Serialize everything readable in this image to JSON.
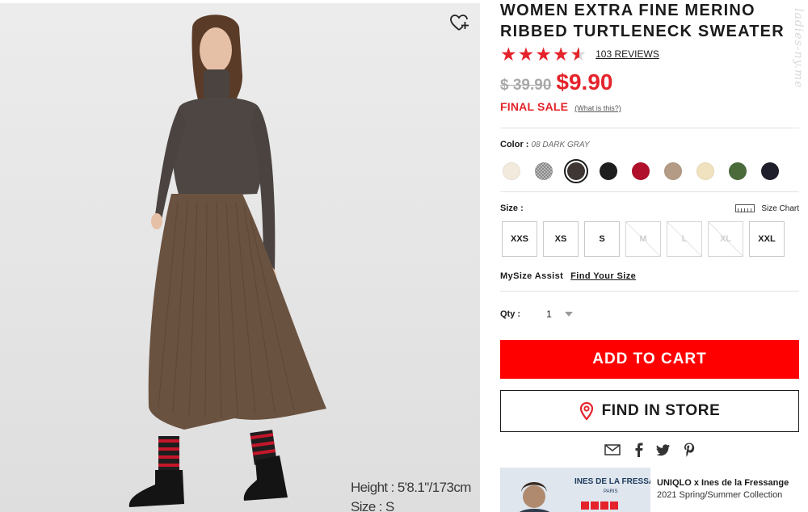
{
  "product": {
    "title_line1": "WOMEN EXTRA FINE MERINO",
    "title_line2": "RIBBED TURTLENECK SWEATER",
    "rating": 4.5,
    "reviews_label": "103 REVIEWS",
    "old_price": "$ 39.90",
    "new_price": "$9.90",
    "final_sale": "FINAL SALE",
    "what_is_this": "(What is this?)"
  },
  "image": {
    "height_text": "Height : 5'8.1\"/173cm",
    "size_text": "Size : S",
    "wishlist_icon": "heart-plus-icon"
  },
  "color": {
    "label": "Color :",
    "selected": "08 DARK GRAY",
    "swatches": [
      "#f2eadc",
      "checker",
      "#3e3733",
      "#1e1e1e",
      "#b0102b",
      "#b49b85",
      "#f1e2bf",
      "#4b6b3b",
      "#1f1f2b"
    ],
    "selected_index": 2
  },
  "size": {
    "label": "Size :",
    "chart_label": "Size Chart",
    "options": [
      {
        "label": "XXS",
        "available": true
      },
      {
        "label": "XS",
        "available": true
      },
      {
        "label": "S",
        "available": true
      },
      {
        "label": "M",
        "available": false
      },
      {
        "label": "L",
        "available": false
      },
      {
        "label": "XL",
        "available": false
      },
      {
        "label": "XXL",
        "available": true
      }
    ]
  },
  "mysize": {
    "label": "MySize Assist",
    "link": "Find Your Size"
  },
  "qty": {
    "label": "Qty :",
    "value": "1"
  },
  "buttons": {
    "add_to_cart": "ADD TO CART",
    "find_in_store": "FIND IN STORE"
  },
  "share_icons": [
    "email-icon",
    "facebook-icon",
    "twitter-icon",
    "pinterest-icon"
  ],
  "promo": {
    "banner_title": "INES DE LA FRESSANGE",
    "banner_city": "PARIS",
    "brand": "UNIQLO",
    "heading": "UNIQLO x Ines de la Fressange",
    "subheading": "2021 Spring/Summer Collection"
  },
  "watermark": "ladies-ny.me",
  "colors": {
    "accent_red": "#e4232b",
    "cart_red": "#ff0000"
  }
}
